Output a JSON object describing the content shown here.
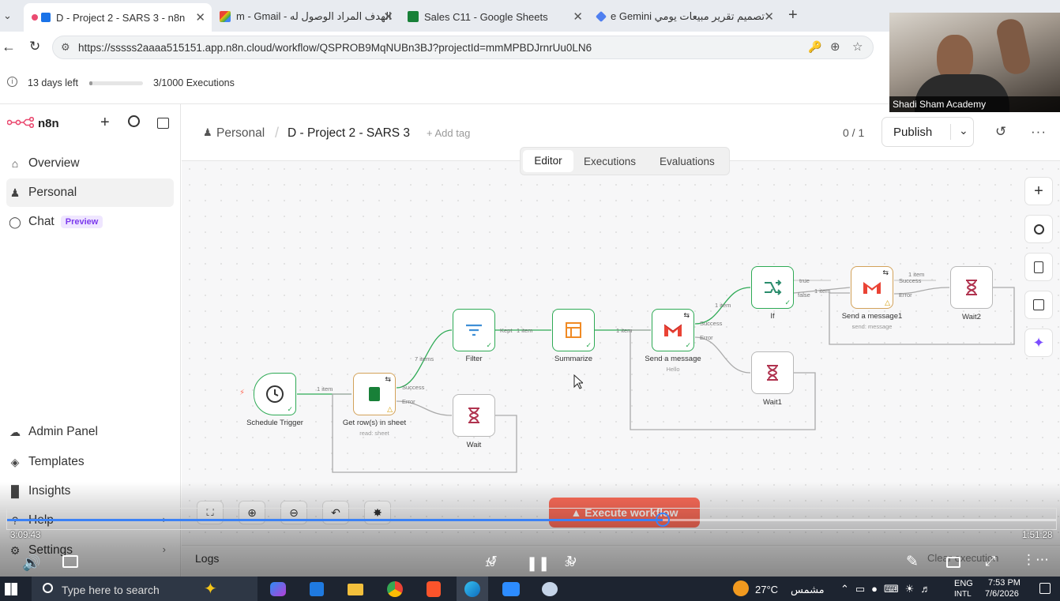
{
  "browser": {
    "tabs": [
      {
        "label": "D - Project 2 - SARS 3 - n8n",
        "active": true
      },
      {
        "label": "m - Gmail - الهدف المراد الوصول له",
        "active": false
      },
      {
        "label": "Sales C11 - Google Sheets",
        "active": false
      },
      {
        "label": "e Gemini تصميم تقرير مبيعات يومي",
        "active": false
      }
    ],
    "url": "https://sssss2aaaa515151.app.n8n.cloud/workflow/QSPROB9MqNUBn3BJ?projectId=mmMPBDJrnrUu0LN6"
  },
  "trial": {
    "days_left": "13 days left",
    "executions": "3/1000 Executions",
    "progress": 0.003
  },
  "sidebar": {
    "brand": "n8n",
    "items": [
      {
        "label": "Overview"
      },
      {
        "label": "Personal"
      },
      {
        "label": "Chat",
        "badge": "Preview"
      }
    ],
    "bottom_items": [
      {
        "label": "Admin Panel"
      },
      {
        "label": "Templates"
      },
      {
        "label": "Insights"
      },
      {
        "label": "Help"
      },
      {
        "label": "Settings"
      }
    ]
  },
  "header": {
    "project": "Personal",
    "workflow_name": "D - Project 2 - SARS 3",
    "add_tag": "+ Add tag",
    "counter": "0 / 1",
    "publish": "Publish",
    "tabs": [
      "Editor",
      "Executions",
      "Evaluations"
    ]
  },
  "workflow": {
    "nodes": [
      {
        "name": "Schedule Trigger",
        "sub": ""
      },
      {
        "name": "Get row(s) in sheet",
        "sub": "read: sheet"
      },
      {
        "name": "Filter",
        "sub": ""
      },
      {
        "name": "Summarize",
        "sub": ""
      },
      {
        "name": "Send a message",
        "sub": "Hello"
      },
      {
        "name": "If",
        "sub": ""
      },
      {
        "name": "Send a message1",
        "sub": "send: message"
      },
      {
        "name": "Wait2",
        "sub": ""
      },
      {
        "name": "Wait1",
        "sub": ""
      },
      {
        "name": "Wait",
        "sub": ""
      }
    ],
    "edge_labels": {
      "e1": "1 item",
      "e2": "7 items",
      "e3": "Kept",
      "e3b": "1 item",
      "e4": "1 item",
      "e5": "1 item",
      "e6": "1 item",
      "e7": "1 item",
      "success": "Success",
      "error": "Error",
      "true": "true",
      "false": "false"
    },
    "execute_button": "Execute workflow",
    "logs": "Logs",
    "clear_execution": "Clear execution"
  },
  "video": {
    "channel": "Shadi Sham Academy",
    "time_current": "3:09:43",
    "time_total": "1:51:28",
    "progress": 0.625,
    "skip_back": "10",
    "skip_forward": "30"
  },
  "taskbar": {
    "search_placeholder": "Type here to search",
    "temperature": "27°C",
    "weather": "مشمس",
    "lang": "ENG",
    "lang2": "INTL",
    "time": "7:53 PM",
    "date": "7/6/2026"
  },
  "colors": {
    "accent": "#ea4b71",
    "success": "#2eaa55",
    "execute": "#ff6d5a"
  }
}
